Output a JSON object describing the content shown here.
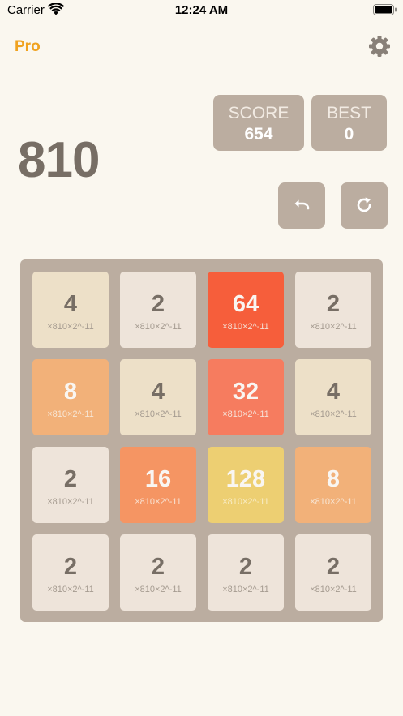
{
  "status_bar": {
    "carrier": "Carrier",
    "time": "12:24 AM"
  },
  "header": {
    "pro_label": "Pro",
    "settings_icon": "gear-icon"
  },
  "target_number": "810",
  "score": {
    "label": "SCORE",
    "value": "654"
  },
  "best": {
    "label": "BEST",
    "value": "0"
  },
  "controls": {
    "undo_icon": "undo-icon",
    "restart_icon": "restart-icon"
  },
  "board": {
    "tiles": [
      {
        "value": "4",
        "formula": "×810×2^-11",
        "bg": "#ede0c8",
        "fg": "#776e65",
        "sub": "#a59b90"
      },
      {
        "value": "2",
        "formula": "×810×2^-11",
        "bg": "#eee4da",
        "fg": "#776e65",
        "sub": "#a59b90"
      },
      {
        "value": "64",
        "formula": "×810×2^-11",
        "bg": "#f65e3b",
        "fg": "#f9f6f2",
        "sub": "#f4ddd2"
      },
      {
        "value": "2",
        "formula": "×810×2^-11",
        "bg": "#eee4da",
        "fg": "#776e65",
        "sub": "#a59b90"
      },
      {
        "value": "8",
        "formula": "×810×2^-11",
        "bg": "#f2b179",
        "fg": "#f9f6f2",
        "sub": "#f7e6d5"
      },
      {
        "value": "4",
        "formula": "×810×2^-11",
        "bg": "#ede0c8",
        "fg": "#776e65",
        "sub": "#a59b90"
      },
      {
        "value": "32",
        "formula": "×810×2^-11",
        "bg": "#f67c5f",
        "fg": "#f9f6f2",
        "sub": "#f6e0d6"
      },
      {
        "value": "4",
        "formula": "×810×2^-11",
        "bg": "#ede0c8",
        "fg": "#776e65",
        "sub": "#a59b90"
      },
      {
        "value": "2",
        "formula": "×810×2^-11",
        "bg": "#eee4da",
        "fg": "#776e65",
        "sub": "#a59b90"
      },
      {
        "value": "16",
        "formula": "×810×2^-11",
        "bg": "#f59563",
        "fg": "#f9f6f2",
        "sub": "#f8e2d2"
      },
      {
        "value": "128",
        "formula": "×810×2^-11",
        "bg": "#edcf72",
        "fg": "#f9f6f2",
        "sub": "#f8ecc5"
      },
      {
        "value": "8",
        "formula": "×810×2^-11",
        "bg": "#f2b179",
        "fg": "#f9f6f2",
        "sub": "#f7e6d5"
      },
      {
        "value": "2",
        "formula": "×810×2^-11",
        "bg": "#eee4da",
        "fg": "#776e65",
        "sub": "#a59b90"
      },
      {
        "value": "2",
        "formula": "×810×2^-11",
        "bg": "#eee4da",
        "fg": "#776e65",
        "sub": "#a59b90"
      },
      {
        "value": "2",
        "formula": "×810×2^-11",
        "bg": "#eee4da",
        "fg": "#776e65",
        "sub": "#a59b90"
      },
      {
        "value": "2",
        "formula": "×810×2^-11",
        "bg": "#eee4da",
        "fg": "#776e65",
        "sub": "#a59b90"
      }
    ]
  }
}
